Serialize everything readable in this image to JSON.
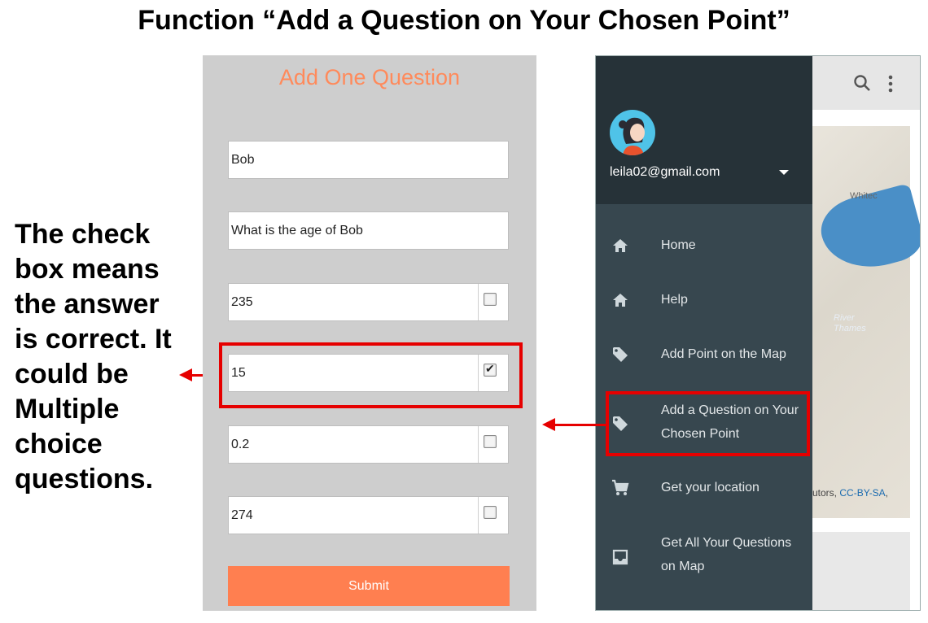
{
  "slide": {
    "title": "Function “Add a Question on Your Chosen Point”",
    "note": "The check box means the answer is correct. It could be Multiple choice questions."
  },
  "form": {
    "heading": "Add One Question",
    "fields": [
      {
        "value": "Bob",
        "has_checkbox": false
      },
      {
        "value": "What is the age of Bob",
        "has_checkbox": false
      },
      {
        "value": "235",
        "has_checkbox": true,
        "checked": false
      },
      {
        "value": "15",
        "has_checkbox": true,
        "checked": true
      },
      {
        "value": "0.2",
        "has_checkbox": true,
        "checked": false
      },
      {
        "value": "274",
        "has_checkbox": true,
        "checked": false
      }
    ],
    "submit_label": "Submit",
    "accent_color": "#ff7f50"
  },
  "drawer": {
    "email": "leila02@gmail.com",
    "items": [
      {
        "label": "Home",
        "icon": "home-icon"
      },
      {
        "label": "Help",
        "icon": "home-icon"
      },
      {
        "label": "Add Point on the Map",
        "icon": "tag-icon"
      },
      {
        "label": "Add a Question on Your Chosen Point",
        "icon": "tag-icon",
        "highlighted": true
      },
      {
        "label": "Get your location",
        "icon": "cart-icon"
      },
      {
        "label": "Get All Your Questions on Map",
        "icon": "inbox-icon"
      }
    ]
  },
  "map": {
    "label_top": "Whitec",
    "label_river": "River Thames",
    "attribution_prefix": "utors, ",
    "attribution_link": "CC-BY-SA",
    "attribution_suffix": ","
  },
  "colors": {
    "highlight": "#e60000",
    "drawer_bg": "#37474f",
    "drawer_header_bg": "#263238"
  }
}
